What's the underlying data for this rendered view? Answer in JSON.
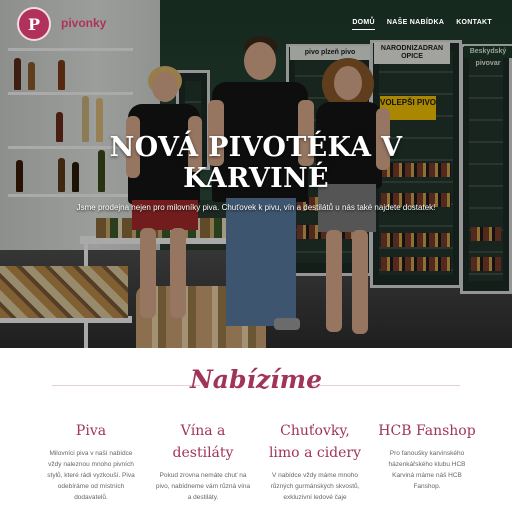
{
  "brand": {
    "logo_letter": "P",
    "logo_text": "pivonky"
  },
  "nav": {
    "items": [
      {
        "label": "DOMŮ",
        "active": true
      },
      {
        "label": "NAŠE NABÍDKA",
        "active": false
      },
      {
        "label": "KONTAKT",
        "active": false
      }
    ]
  },
  "hero": {
    "title": "NOVÁ PIVOTÉKA V KARVINÉ",
    "subtitle": "Jsme prodejna nejen pro milovníky piva. Chuťovek k pivu, vín a destilátů u nás také najdete dostatek!",
    "signs": [
      "pivo plzeň pivo",
      "NARODNIZADRAN OPICE",
      "Beskydský pivovar",
      "VOLEPŠI PIVO"
    ]
  },
  "offers": {
    "title": "Nabízíme",
    "items": [
      {
        "title": "Piva",
        "text": "Milovníci piva v naší nabídce vždy naleznou mnoho pivních stylů, které rádi vyzkouší. Piva odebíráme od místních dodavatelů."
      },
      {
        "title": "Vína a destiláty",
        "text": "Pokud zrovna nemáte chuť na pivo, nabídneme vám různá vína a destiláty."
      },
      {
        "title": "Chuťovky, limo a cidery",
        "text": "V nabídce vždy máme mnoho různých gurmánských skvostů, exkluzivní ledové čaje"
      },
      {
        "title": "HCB Fanshop",
        "text": "Pro fanoušky karvinského házenkářského klubu HCB Karviná máme náš HCB Fanshop."
      }
    ]
  },
  "colors": {
    "brand": "#a13459",
    "text_muted": "#666666",
    "hero_backdrop": "#1f3a2c"
  }
}
